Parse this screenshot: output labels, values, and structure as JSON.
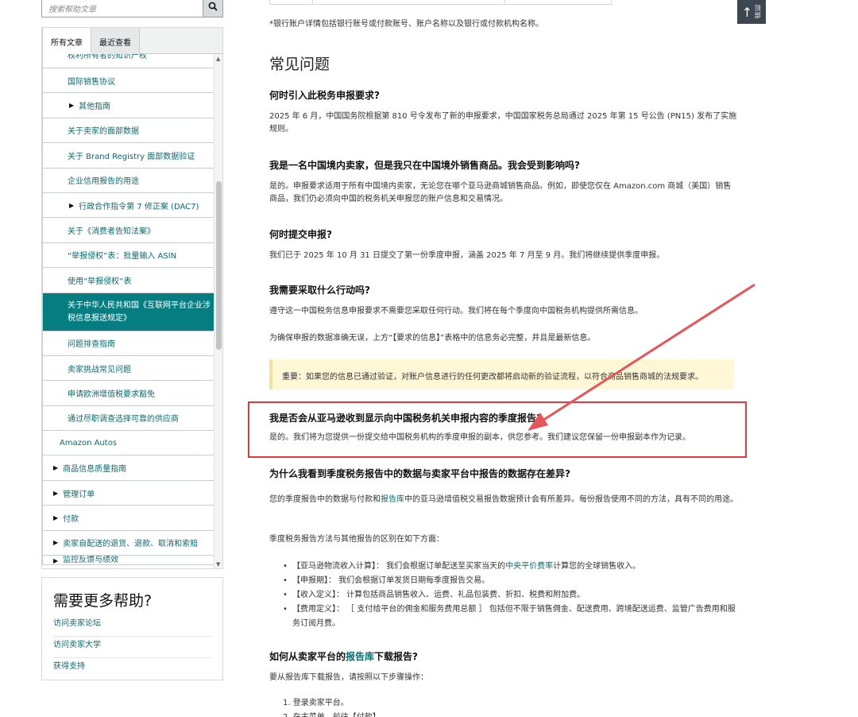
{
  "search": {
    "placeholder": "搜索帮助文章"
  },
  "tabs": [
    {
      "label": "所有文章"
    },
    {
      "label": "最近查看"
    }
  ],
  "nav": {
    "top_cut": "权利所有者的知识产权",
    "items": [
      "国际销售协议",
      "其他指南",
      "关于卖家的面部数据",
      "关于 Brand Registry 面部数据验证",
      "企业信用报告的用途",
      "行政合作指令第 7 修正案 (DAC7)",
      "关于《消费者告知法案》",
      "“举报侵权”表：批量输入 ASIN",
      "使用“举报侵权”表",
      "关于中华人民共和国《互联网平台企业涉税信息报送规定》",
      "问题排查指南",
      "卖家挑战常见问题",
      "申请欧洲增值税要求豁免",
      "通过尽职调查选择可靠的供应商",
      "Amazon Autos",
      "商品信息质量指南",
      "管理订单",
      "付款",
      "卖家自配送的退货、退款、取消和索赔",
      "监控反馈与绩效"
    ]
  },
  "help": {
    "title": "需要更多帮助?",
    "links": [
      "访问卖家论坛",
      "访问卖家大学",
      "获得支持"
    ]
  },
  "main": {
    "footnote": "*银行账户详情包括银行账号或付款账号、账户名称以及银行或付款机构名称。",
    "faq_title": "常见问题",
    "q1": "何时引入此税务申报要求?",
    "a1": "2025 年 6 月，中国国务院根据第 810 号令发布了新的申报要求，中国国家税务总局通过 2025 年第 15 号公告 (PN15) 发布了实施规则。",
    "q2": "我是一名中国境内卖家，但是我只在中国境外销售商品。我会受到影响吗?",
    "a2": "是的。申报要求适用于所有中国境内卖家，无论您在哪个亚马逊商城销售商品。例如，即使您仅在 Amazon.com 商城（美国）销售商品，我们仍必须向中国的税务机关申报您的账户信息和交易情况。",
    "q3": "何时提交申报?",
    "a3": "我们已于 2025 年 10 月 31 日提交了第一份季度申报，涵盖 2025 年 7 月至 9 月。我们将继续提供季度申报。",
    "q4": "我需要采取什么行动吗?",
    "a4a": "遵守这一中国税务信息申报要求不需要您采取任何行动。我们将在每个季度向中国税务机构提供所需信息。",
    "a4b": "为确保申报的数据准确无误，上方“【要求的信息】”表格中的信息务必完整，并且是最新信息。",
    "note": "重要：如果您的信息已通过验证，对账户信息进行的任何更改都将启动新的验证流程，以符合商品销售商城的法规要求。",
    "q5": "我是否会从亚马逊收到显示向中国税务机关申报内容的季度报告?",
    "a5": "是的。我们将为您提供一份提交给中国税务机构的季度申报的副本，供您参考。我们建议您保留一份申报副本作为记录。",
    "q6": "为什么我看到季度税务报告中的数据与卖家平台中报告的数据存在差异?",
    "a6_pre": "您的季度报告中的数据与付款和",
    "a6_link": "报告库",
    "a6_post": "中的亚马逊增值税交易报告数据预计会有所差异。每份报告使用不同的方法，具有不同的用途。",
    "a6b": "季度税务报告方法与其他报告的区别在如下方面：",
    "list": [
      {
        "pre": "【亚马逊物流收入计算】： 我们会根据订单配送至买家当天的",
        "link": "中央平价费率",
        "post": "计算您的全球销售收入。"
      },
      {
        "pre": "【申报期】： 我们会根据订单发货日期每季度报告交易。",
        "link": "",
        "post": ""
      },
      {
        "pre": "【收入定义】： 计算包括商品销售收入、运费、礼品包装费、折扣、税费和附加费。",
        "link": "",
        "post": ""
      },
      {
        "pre": "【费用定义】： ［ 支付给平台的佣金和服务费用总额 ］ 包括但不限于销售佣金、配送费用、跨境配送运费、监管广告费用和服务订阅月费。",
        "link": "",
        "post": ""
      }
    ],
    "q7_pre": "如何从卖家平台的",
    "q7_link": "报告库",
    "q7_post": "下载报告?",
    "a7": "要从报告库下载报告，请按照以下步骤操作：",
    "steps": [
      "1. 登录卖家平台。",
      "2. 在主菜单，前往【付款】"
    ]
  },
  "top_button": {
    "label": "顶部"
  },
  "colors": {
    "accent": "#067d80",
    "link": "#0a6b6f",
    "annotation": "#e23a3a",
    "note_bg": "#fff7d6"
  }
}
